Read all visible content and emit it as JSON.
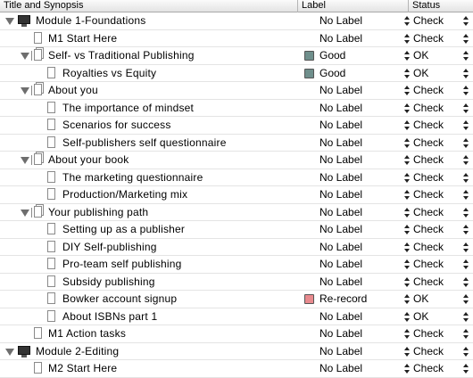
{
  "columns": {
    "title": "Title and Synopsis",
    "label": "Label",
    "status": "Status"
  },
  "label_colors": {
    "Good": "#6f8f8c",
    "Re-record": "#e88a8e"
  },
  "rows": [
    {
      "title": "Module 1-Foundations",
      "icon": "monitor-icon",
      "expand": "expanded",
      "label": "No Label",
      "status": "Check"
    },
    {
      "title": "M1 Start Here",
      "icon": "document-icon",
      "expand": "none",
      "label": "No Label",
      "status": "Check"
    },
    {
      "title": "Self- vs Traditional Publishing",
      "icon": "document-stack-icon",
      "expand": "expanded",
      "label": "Good",
      "status": "OK"
    },
    {
      "title": "Royalties vs Equity",
      "icon": "document-icon",
      "expand": "none",
      "label": "Good",
      "status": "OK"
    },
    {
      "title": "About you",
      "icon": "document-stack-icon",
      "expand": "expanded",
      "label": "No Label",
      "status": "Check"
    },
    {
      "title": "The importance of mindset",
      "icon": "document-icon",
      "expand": "none",
      "label": "No Label",
      "status": "Check"
    },
    {
      "title": "Scenarios for success",
      "icon": "document-icon",
      "expand": "none",
      "label": "No Label",
      "status": "Check"
    },
    {
      "title": "Self-publishers self questionnaire",
      "icon": "document-icon",
      "expand": "none",
      "label": "No Label",
      "status": "Check"
    },
    {
      "title": "About your book",
      "icon": "document-stack-icon",
      "expand": "expanded",
      "label": "No Label",
      "status": "Check"
    },
    {
      "title": "The marketing questionnaire",
      "icon": "document-icon",
      "expand": "none",
      "label": "No Label",
      "status": "Check"
    },
    {
      "title": "Production/Marketing mix",
      "icon": "document-icon",
      "expand": "none",
      "label": "No Label",
      "status": "Check"
    },
    {
      "title": "Your publishing path",
      "icon": "document-stack-icon",
      "expand": "expanded",
      "label": "No Label",
      "status": "Check"
    },
    {
      "title": "Setting up as a publisher",
      "icon": "document-icon",
      "expand": "none",
      "label": "No Label",
      "status": "Check"
    },
    {
      "title": "DIY Self-publishing",
      "icon": "document-icon",
      "expand": "none",
      "label": "No Label",
      "status": "Check"
    },
    {
      "title": "Pro-team self publishing",
      "icon": "document-icon",
      "expand": "none",
      "label": "No Label",
      "status": "Check"
    },
    {
      "title": "Subsidy publishing",
      "icon": "document-icon",
      "expand": "none",
      "label": "No Label",
      "status": "Check"
    },
    {
      "title": "Bowker account signup",
      "icon": "document-icon",
      "expand": "none",
      "label": "Re-record",
      "status": "OK"
    },
    {
      "title": "About ISBNs part 1",
      "icon": "document-icon",
      "expand": "none",
      "label": "No Label",
      "status": "OK"
    },
    {
      "title": "M1 Action tasks",
      "icon": "document-icon",
      "expand": "none",
      "label": "No Label",
      "status": "Check"
    },
    {
      "title": "Module 2-Editing",
      "icon": "monitor-icon",
      "expand": "expanded",
      "label": "No Label",
      "status": "Check"
    },
    {
      "title": "M2 Start Here",
      "icon": "document-icon",
      "expand": "none",
      "label": "No Label",
      "status": "Check"
    }
  ]
}
